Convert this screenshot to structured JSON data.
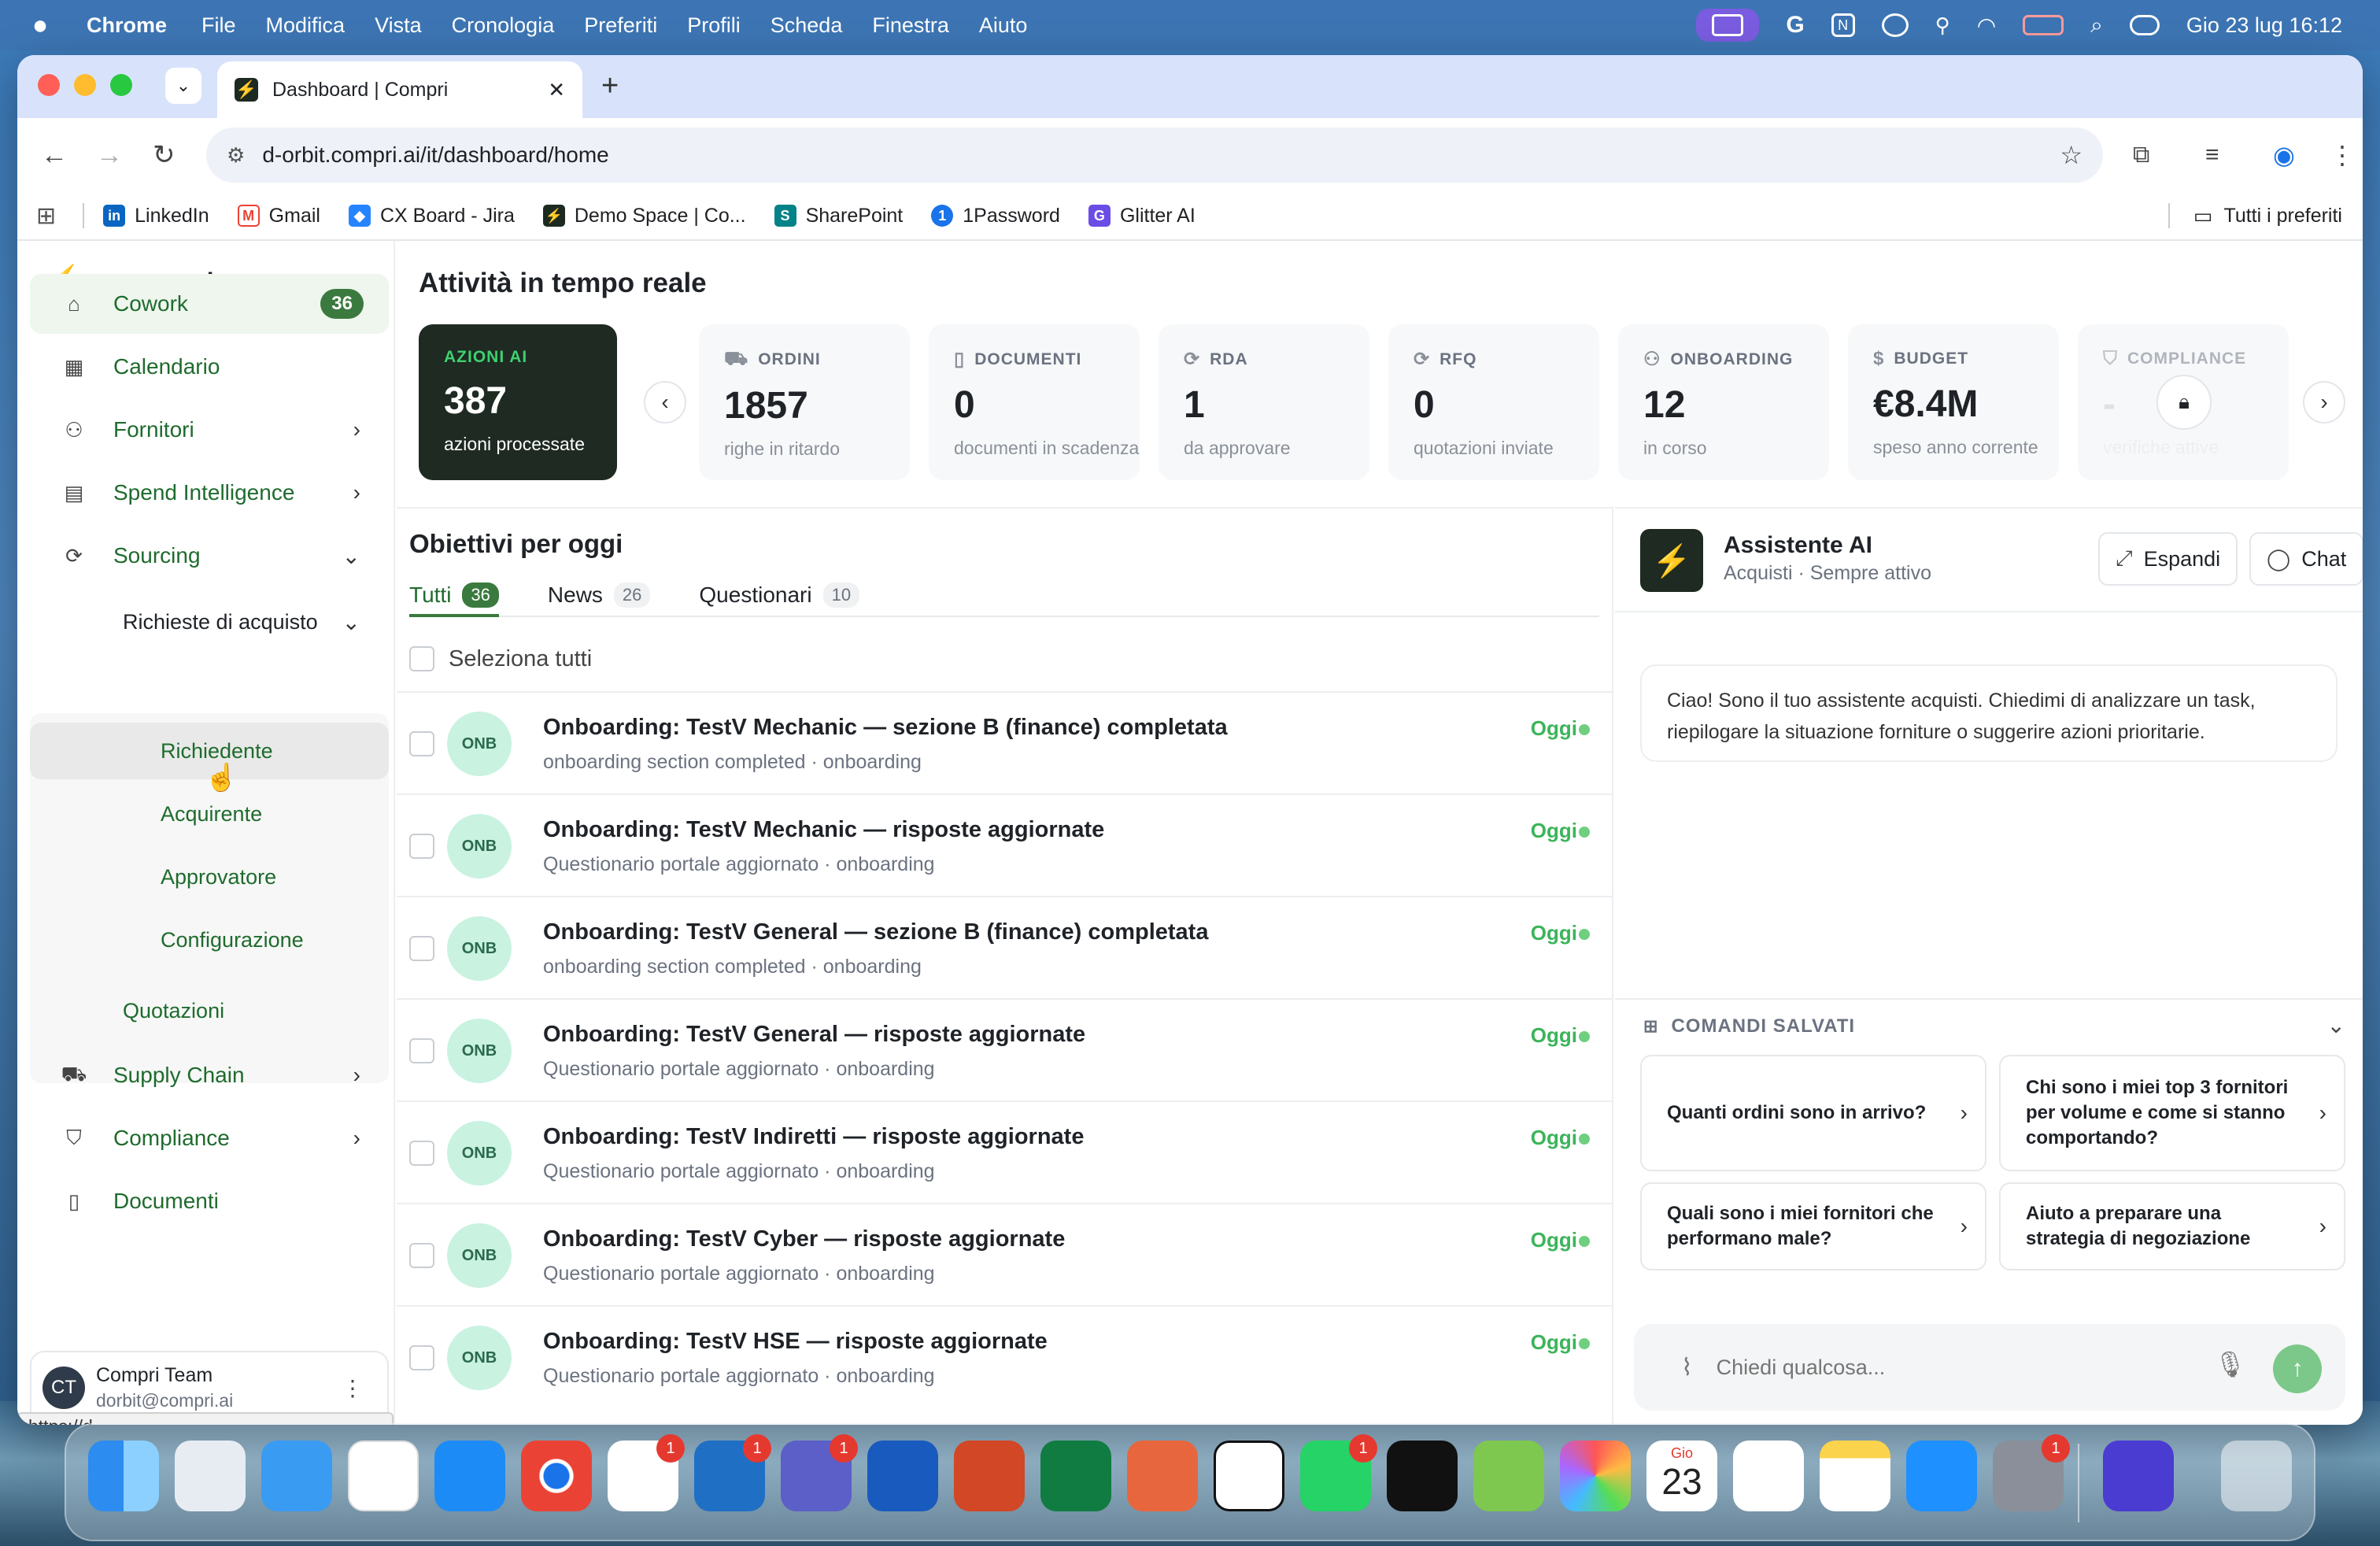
{
  "menubar": {
    "app_name": "Chrome",
    "items": [
      "File",
      "Modifica",
      "Vista",
      "Cronologia",
      "Preferiti",
      "Profili",
      "Scheda",
      "Finestra",
      "Aiuto"
    ],
    "datetime": "Gio 23 lug  16:12"
  },
  "browser": {
    "tab_title": "Dashboard | Compri",
    "url": "d-orbit.compri.ai/it/dashboard/home",
    "bookmarks": [
      "LinkedIn",
      "Gmail",
      "CX Board - Jira",
      "Demo Space | Co...",
      "SharePoint",
      "1Password",
      "Glitter AI"
    ],
    "all_bookmarks": "Tutti i preferiti",
    "status_url": "https://d-orbit.compri.ai/dashboard/rfp/requester"
  },
  "sidebar": {
    "logo": "compri",
    "nav": {
      "cowork": "Cowork",
      "cowork_badge": "36",
      "calendario": "Calendario",
      "fornitori": "Fornitori",
      "spend": "Spend Intelligence",
      "sourcing": "Sourcing",
      "richieste": "Richieste di acquisto",
      "richiedente": "Richiedente",
      "acquirente": "Acquirente",
      "approvatore": "Approvatore",
      "configurazione": "Configurazione",
      "quotazioni": "Quotazioni",
      "supply": "Supply Chain",
      "compliance": "Compliance",
      "documenti": "Documenti"
    },
    "user": {
      "initials": "CT",
      "name": "Compri Team",
      "email": "dorbit@compri.ai"
    }
  },
  "realtime": {
    "title": "Attività in tempo reale",
    "cards": [
      {
        "label": "AZIONI AI",
        "value": "387",
        "sub": "azioni processate"
      },
      {
        "label": "ORDINI",
        "value": "1857",
        "sub": "righe in ritardo"
      },
      {
        "label": "DOCUMENTI",
        "value": "0",
        "sub": "documenti in scadenza"
      },
      {
        "label": "RDA",
        "value": "1",
        "sub": "da approvare"
      },
      {
        "label": "RFQ",
        "value": "0",
        "sub": "quotazioni inviate"
      },
      {
        "label": "ONBOARDING",
        "value": "12",
        "sub": "in corso"
      },
      {
        "label": "BUDGET",
        "value": "€8.4M",
        "sub": "speso anno corrente"
      },
      {
        "label": "COMPLIANCE",
        "value": "-",
        "sub": "verifiche attive"
      }
    ]
  },
  "objectives": {
    "title": "Obiettivi per oggi",
    "tabs": [
      {
        "label": "Tutti",
        "count": "36"
      },
      {
        "label": "News",
        "count": "26"
      },
      {
        "label": "Questionari",
        "count": "10"
      }
    ],
    "select_all": "Seleziona tutti",
    "avatar_text": "ONB",
    "items": [
      {
        "title": "Onboarding: TestV Mechanic — sezione B (finance) completata",
        "sub": "onboarding section completed · onboarding",
        "when": "Oggi"
      },
      {
        "title": "Onboarding: TestV Mechanic — risposte aggiornate",
        "sub": "Questionario portale aggiornato · onboarding",
        "when": "Oggi"
      },
      {
        "title": "Onboarding: TestV General — sezione B (finance) completata",
        "sub": "onboarding section completed · onboarding",
        "when": "Oggi"
      },
      {
        "title": "Onboarding: TestV General — risposte aggiornate",
        "sub": "Questionario portale aggiornato · onboarding",
        "when": "Oggi"
      },
      {
        "title": "Onboarding: TestV Indiretti — risposte aggiornate",
        "sub": "Questionario portale aggiornato · onboarding",
        "when": "Oggi"
      },
      {
        "title": "Onboarding: TestV Cyber — risposte aggiornate",
        "sub": "Questionario portale aggiornato · onboarding",
        "when": "Oggi"
      },
      {
        "title": "Onboarding: TestV HSE — risposte aggiornate",
        "sub": "Questionario portale aggiornato · onboarding",
        "when": "Oggi"
      }
    ]
  },
  "assistant": {
    "name": "Assistente AI",
    "subtitle": "Acquisti · Sempre attivo",
    "expand": "Espandi",
    "chat": "Chat",
    "greeting": "Ciao! Sono il tuo assistente acquisti. Chiedimi di analizzare un task, riepilogare la situazione forniture o suggerire azioni prioritarie.",
    "saved_title": "COMANDI SALVATI",
    "commands": [
      "Quanti ordini sono in arrivo?",
      "Chi sono i miei top 3 fornitori per volume e come si stanno comportando?",
      "Quali sono i miei fornitori che performano male?",
      "Aiuto a preparare una strategia di negoziazione"
    ],
    "input_placeholder": "Chiedi qualcosa..."
  },
  "dock": {
    "calendar_month": "Gio",
    "calendar_day": "23",
    "badge": "1"
  },
  "colors": {
    "brand_green": "#3b7a3e",
    "accent_green": "#3cc86a",
    "dark_card": "#1e2a22"
  }
}
